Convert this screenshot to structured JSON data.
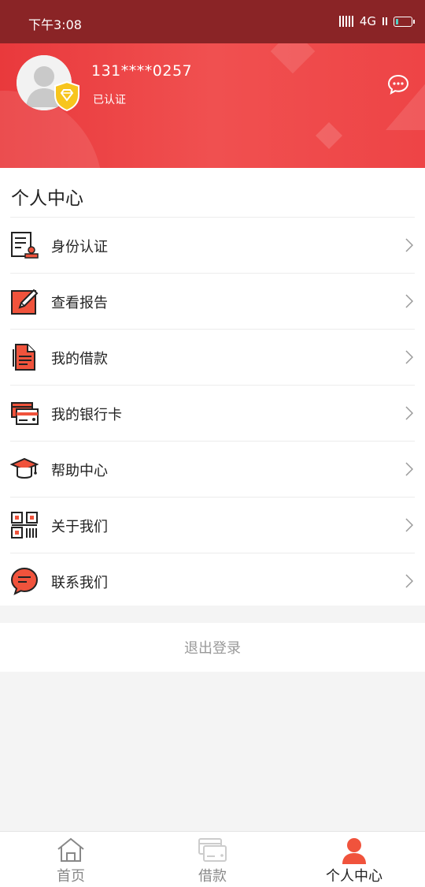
{
  "status_bar": {
    "time": "下午3:08",
    "network": "4G"
  },
  "header": {
    "phone": "131****0257",
    "status": "已认证"
  },
  "main": {
    "title": "个人中心",
    "items": [
      {
        "label": "身份认证",
        "icon": "id-verify-icon"
      },
      {
        "label": "查看报告",
        "icon": "report-edit-icon"
      },
      {
        "label": "我的借款",
        "icon": "loan-document-icon"
      },
      {
        "label": "我的银行卡",
        "icon": "bank-card-icon"
      },
      {
        "label": "帮助中心",
        "icon": "graduation-cap-icon"
      },
      {
        "label": "关于我们",
        "icon": "qr-code-icon"
      },
      {
        "label": "联系我们",
        "icon": "chat-bubble-icon"
      }
    ]
  },
  "logout_label": "退出登录",
  "tabbar": [
    {
      "label": "首页"
    },
    {
      "label": "借款"
    },
    {
      "label": "个人中心",
      "active": true
    }
  ],
  "colors": {
    "brand": "#e9393c",
    "status_bar": "#8a2426",
    "active_tab_icon": "#f0533c"
  }
}
